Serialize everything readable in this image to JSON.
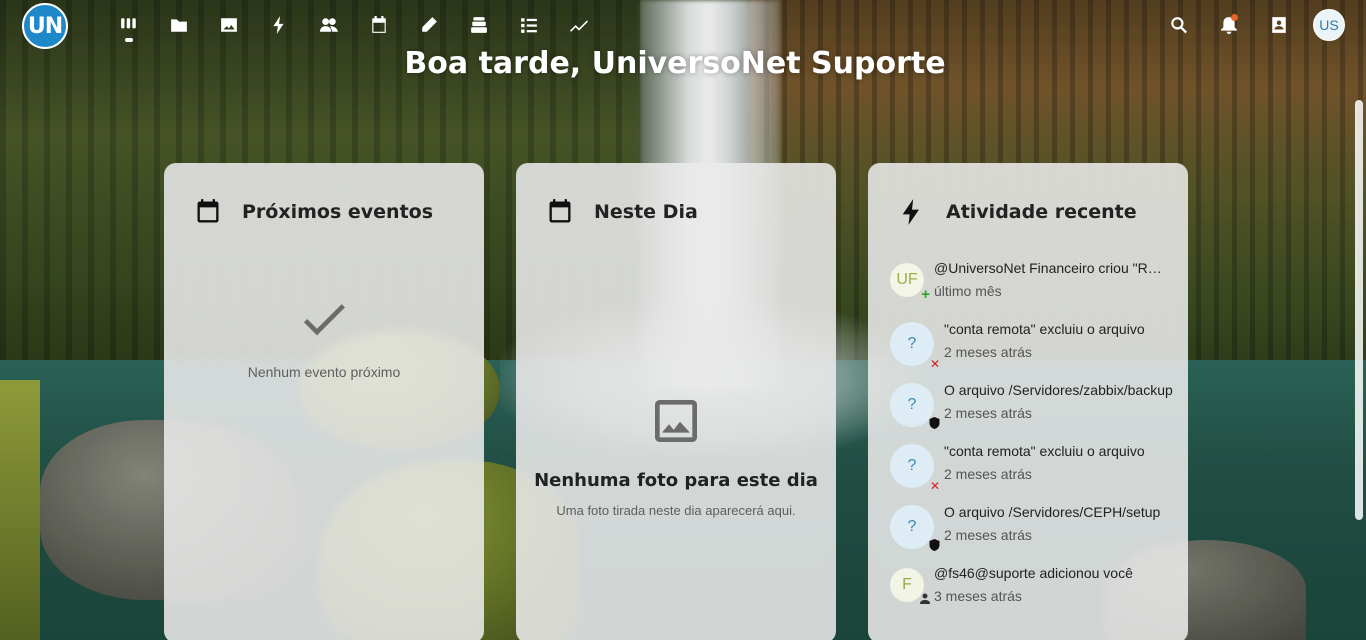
{
  "header": {
    "logo_text": "UN",
    "nav": [
      {
        "name": "dashboard-icon",
        "active": true
      },
      {
        "name": "files-icon"
      },
      {
        "name": "photos-icon"
      },
      {
        "name": "activity-icon"
      },
      {
        "name": "contacts-icon"
      },
      {
        "name": "calendar-icon"
      },
      {
        "name": "notes-icon"
      },
      {
        "name": "deck-icon"
      },
      {
        "name": "tasks-icon"
      },
      {
        "name": "analytics-icon"
      }
    ],
    "right": [
      "search-icon",
      "notifications-icon",
      "contacts-menu-icon"
    ],
    "avatar_initials": "US"
  },
  "greeting": "Boa tarde, UniversoNet Suporte",
  "panels": {
    "upcoming": {
      "title": "Próximos eventos",
      "empty_text": "Nenhum evento próximo"
    },
    "on_this_day": {
      "title": "Neste Dia",
      "empty_title": "Nenhuma foto para este dia",
      "empty_subtitle": "Uma foto tirada neste dia aparecerá aqui."
    },
    "activity": {
      "title": "Atividade recente",
      "items": [
        {
          "initials": "UF",
          "style": "green",
          "badge": "plus",
          "message": "@UniversoNet Financeiro criou \"Reunião\"",
          "time": "último mês"
        },
        {
          "initials": "?",
          "style": "blue",
          "badge": "x",
          "message": "\"conta remota\" excluiu o arquivo",
          "time": "2 meses atrás"
        },
        {
          "initials": "?",
          "style": "blue",
          "badge": "shield",
          "message": "O arquivo /Servidores/zabbix/backup",
          "time": "2 meses atrás"
        },
        {
          "initials": "?",
          "style": "blue",
          "badge": "x",
          "message": "\"conta remota\" excluiu o arquivo",
          "time": "2 meses atrás"
        },
        {
          "initials": "?",
          "style": "blue",
          "badge": "shield",
          "message": "O arquivo /Servidores/CEPH/setup",
          "time": "2 meses atrás"
        },
        {
          "initials": "F",
          "style": "olive",
          "badge": "user",
          "message": "@fs46@suporte adicionou você",
          "time": "3 meses atrás"
        }
      ]
    }
  }
}
